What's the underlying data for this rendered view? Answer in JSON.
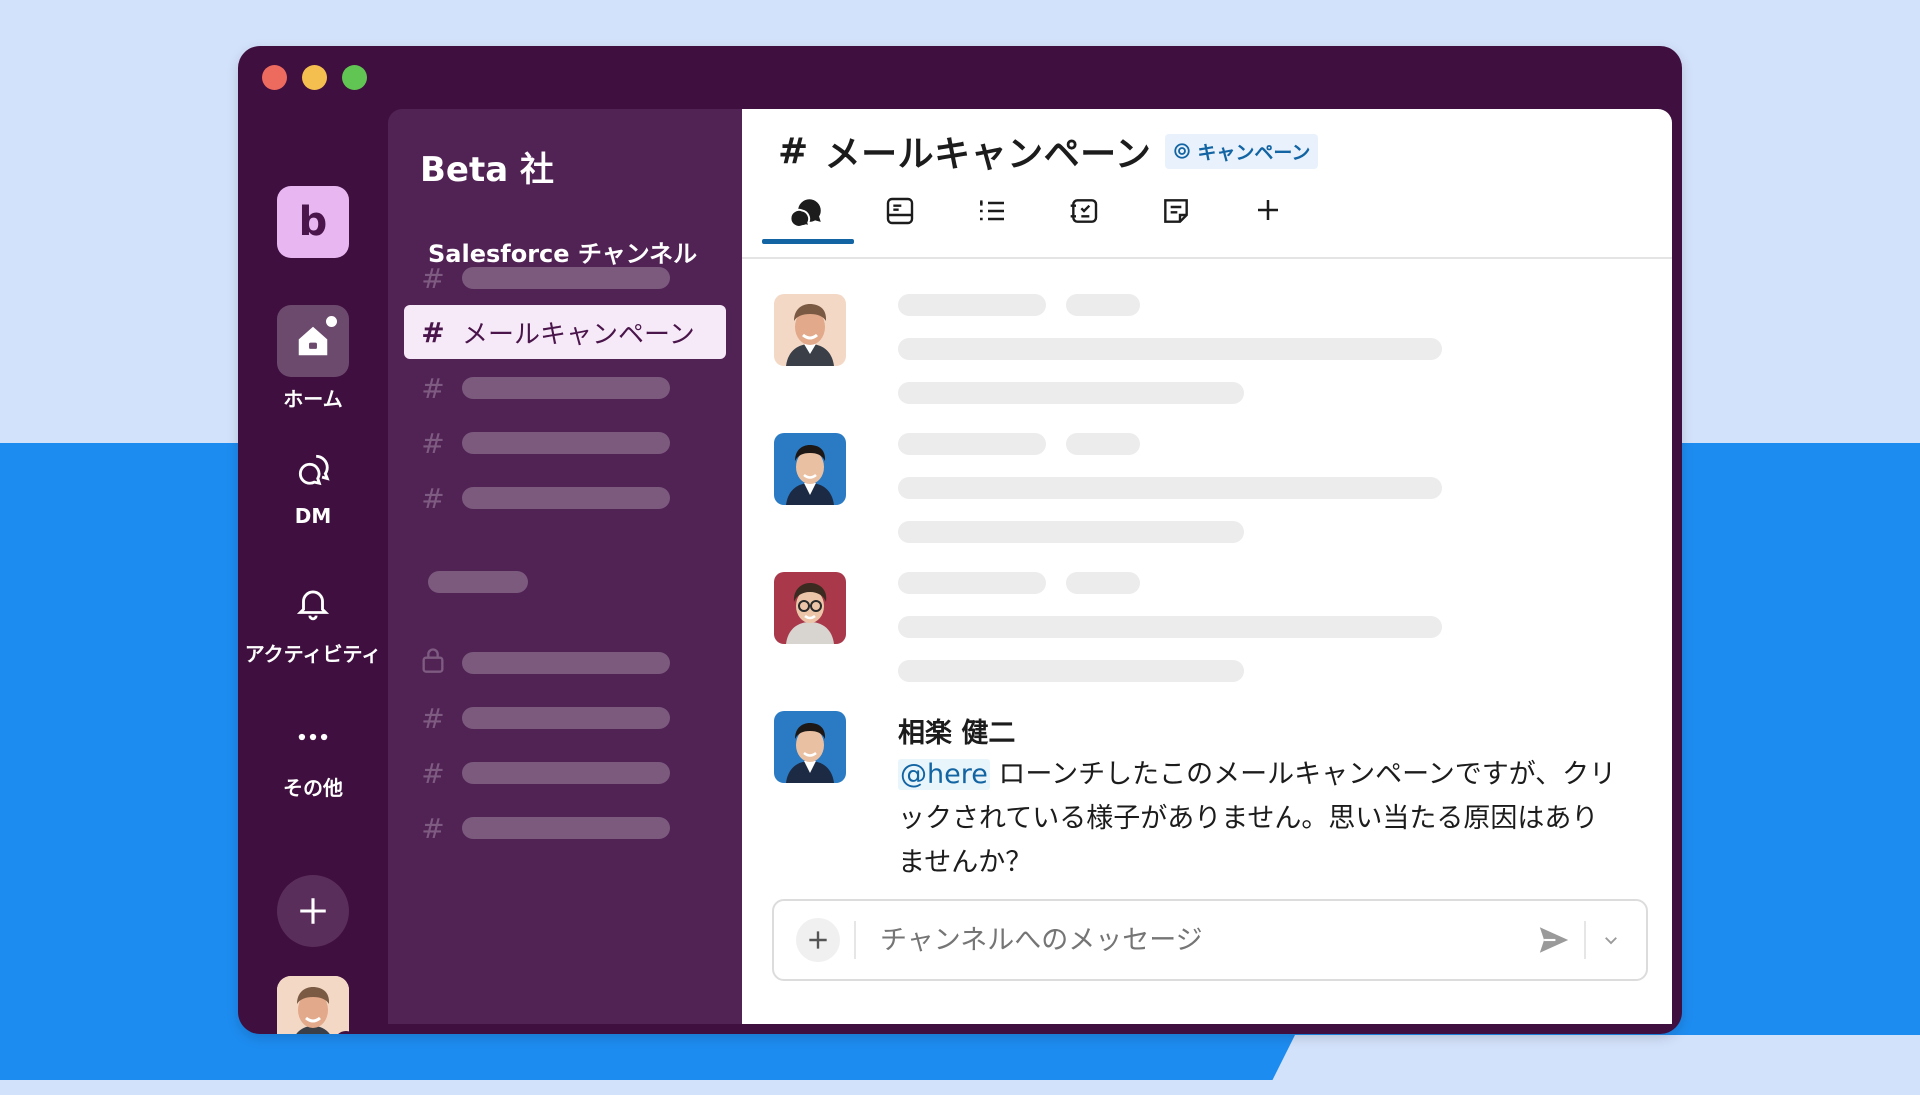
{
  "workspace": {
    "badge_letter": "b",
    "name": "Beta 社"
  },
  "rail": {
    "items": [
      {
        "label": "ホーム",
        "icon": "home-icon"
      },
      {
        "label": "DM",
        "icon": "dm-icon"
      },
      {
        "label": "アクティビティ",
        "icon": "bell-icon"
      },
      {
        "label": "その他",
        "icon": "more-icon"
      }
    ],
    "add_label": "+"
  },
  "sidebar": {
    "section_title": "Salesforce チャンネル",
    "active_channel": "メールキャンペーン",
    "hash": "#"
  },
  "channel": {
    "hash": "#",
    "title": "メールキャンペーン",
    "tag": "キャンペーン",
    "tabs": [
      "messages-tab-icon",
      "canvas-tab-icon",
      "list-tab-icon",
      "workflow-tab-icon",
      "notes-tab-icon",
      "add-tab-icon"
    ]
  },
  "message": {
    "author": "相楽 健二",
    "mention": "@here",
    "text": " ローンチしたこのメールキャンペーンですが、クリックされている様子がありません。思い当たる原因はありませんか？"
  },
  "composer": {
    "placeholder": "チャンネルへのメッセージ"
  },
  "colors": {
    "aubergine": "#3f0f3f",
    "sidebar": "#512254",
    "accent": "#1264a3",
    "online": "#2bac76"
  }
}
